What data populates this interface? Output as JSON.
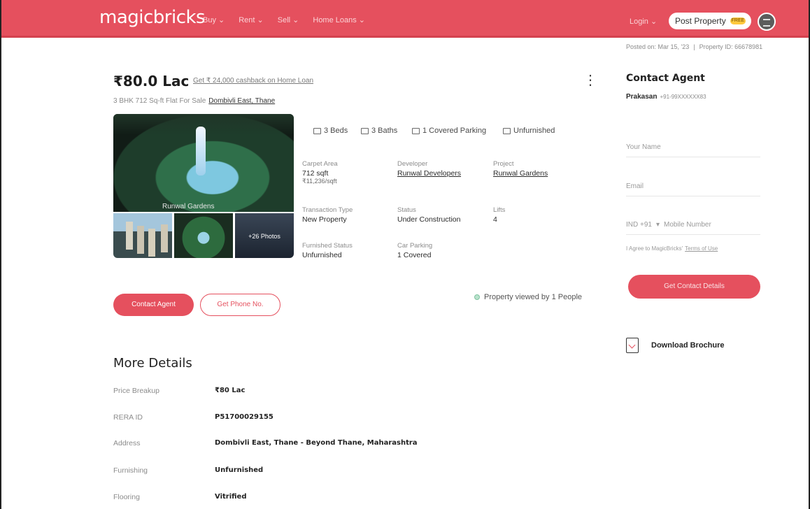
{
  "header": {
    "logo": "magicbricks",
    "nav": [
      "Buy ⌄",
      "Rent ⌄",
      "Sell ⌄",
      "Home Loans ⌄"
    ],
    "login": "Login ⌄",
    "post_property": "Post Property",
    "post_badge": "FREE",
    "brand_color": "#e5505e"
  },
  "meta": {
    "posted_on": "Posted on: Mar 15, '23",
    "property_id": "Property ID: 66678981"
  },
  "summary": {
    "price": "₹80.0 Lac",
    "cashback_link": "Get ₹ 24,000 cashback on Home Loan",
    "subtitle": "3 BHK 712 Sq-ft Flat For Sale",
    "location_link": "Dombivli East, Thane",
    "menu_icon": "⋮"
  },
  "gallery": {
    "caption": "Runwal Gardens",
    "more_photos": "+26 Photos"
  },
  "amenities": [
    {
      "icon": "bed-icon",
      "label": "3 Beds"
    },
    {
      "icon": "bath-icon",
      "label": "3 Baths"
    },
    {
      "icon": "parking-icon",
      "label": "1 Covered Parking"
    },
    {
      "icon": "furniture-icon",
      "label": "Unfurnished"
    }
  ],
  "facts": {
    "carpet_area": {
      "label": "Carpet Area",
      "value": "712 sqft",
      "sub": "₹11,236/sqft"
    },
    "developer": {
      "label": "Developer",
      "value": "Runwal Developers"
    },
    "project": {
      "label": "Project",
      "value": "Runwal Gardens"
    },
    "transaction": {
      "label": "Transaction Type",
      "value": "New Property"
    },
    "status": {
      "label": "Status",
      "value": "Under Construction"
    },
    "lifts": {
      "label": "Lifts",
      "value": "4"
    },
    "furnished": {
      "label": "Furnished Status",
      "value": "Unfurnished"
    },
    "parking": {
      "label": "Car Parking",
      "value": "1 Covered"
    }
  },
  "actions": {
    "contact_agent": "Contact Agent",
    "get_phone": "Get Phone No.",
    "viewed": "Property viewed by 1 People"
  },
  "contact_panel": {
    "title": "Contact Agent",
    "agent_name": "Prakasan",
    "agent_phone": "+91-99XXXXXX83",
    "name_placeholder": "Your Name",
    "email_placeholder": "Email",
    "country_code": "IND +91",
    "mobile_placeholder": "Mobile Number",
    "agree_text": "I Agree to MagicBricks'",
    "terms_link": "Terms of Use",
    "get_details": "Get Contact Details",
    "brochure": "Download Brochure"
  },
  "more_details": {
    "title": "More Details",
    "rows": [
      {
        "key": "Price Breakup",
        "value": "₹80 Lac"
      },
      {
        "key": "RERA ID",
        "value": "P51700029155"
      },
      {
        "key": "Address",
        "value": "Dombivli East, Thane - Beyond Thane, Maharashtra"
      },
      {
        "key": "Furnishing",
        "value": "Unfurnished"
      },
      {
        "key": "Flooring",
        "value": "Vitrified"
      }
    ]
  }
}
